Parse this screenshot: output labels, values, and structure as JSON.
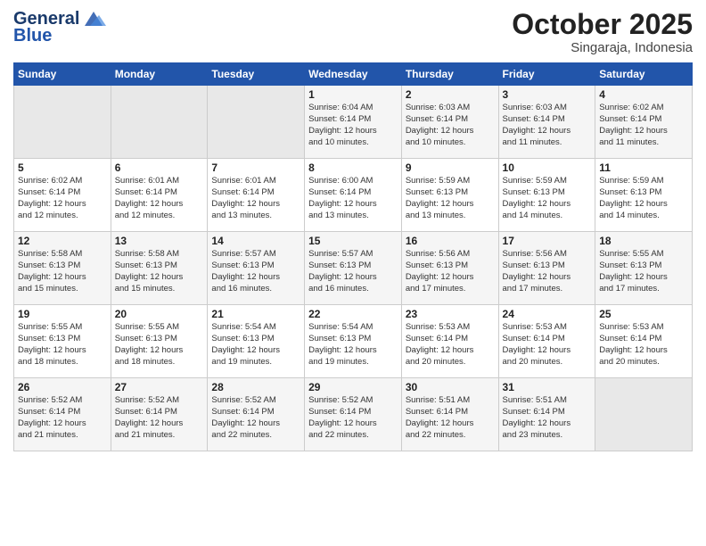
{
  "header": {
    "logo_line1": "General",
    "logo_line2": "Blue",
    "month": "October 2025",
    "location": "Singaraja, Indonesia"
  },
  "weekdays": [
    "Sunday",
    "Monday",
    "Tuesday",
    "Wednesday",
    "Thursday",
    "Friday",
    "Saturday"
  ],
  "weeks": [
    [
      {
        "day": "",
        "info": ""
      },
      {
        "day": "",
        "info": ""
      },
      {
        "day": "",
        "info": ""
      },
      {
        "day": "1",
        "info": "Sunrise: 6:04 AM\nSunset: 6:14 PM\nDaylight: 12 hours\nand 10 minutes."
      },
      {
        "day": "2",
        "info": "Sunrise: 6:03 AM\nSunset: 6:14 PM\nDaylight: 12 hours\nand 10 minutes."
      },
      {
        "day": "3",
        "info": "Sunrise: 6:03 AM\nSunset: 6:14 PM\nDaylight: 12 hours\nand 11 minutes."
      },
      {
        "day": "4",
        "info": "Sunrise: 6:02 AM\nSunset: 6:14 PM\nDaylight: 12 hours\nand 11 minutes."
      }
    ],
    [
      {
        "day": "5",
        "info": "Sunrise: 6:02 AM\nSunset: 6:14 PM\nDaylight: 12 hours\nand 12 minutes."
      },
      {
        "day": "6",
        "info": "Sunrise: 6:01 AM\nSunset: 6:14 PM\nDaylight: 12 hours\nand 12 minutes."
      },
      {
        "day": "7",
        "info": "Sunrise: 6:01 AM\nSunset: 6:14 PM\nDaylight: 12 hours\nand 13 minutes."
      },
      {
        "day": "8",
        "info": "Sunrise: 6:00 AM\nSunset: 6:14 PM\nDaylight: 12 hours\nand 13 minutes."
      },
      {
        "day": "9",
        "info": "Sunrise: 5:59 AM\nSunset: 6:13 PM\nDaylight: 12 hours\nand 13 minutes."
      },
      {
        "day": "10",
        "info": "Sunrise: 5:59 AM\nSunset: 6:13 PM\nDaylight: 12 hours\nand 14 minutes."
      },
      {
        "day": "11",
        "info": "Sunrise: 5:59 AM\nSunset: 6:13 PM\nDaylight: 12 hours\nand 14 minutes."
      }
    ],
    [
      {
        "day": "12",
        "info": "Sunrise: 5:58 AM\nSunset: 6:13 PM\nDaylight: 12 hours\nand 15 minutes."
      },
      {
        "day": "13",
        "info": "Sunrise: 5:58 AM\nSunset: 6:13 PM\nDaylight: 12 hours\nand 15 minutes."
      },
      {
        "day": "14",
        "info": "Sunrise: 5:57 AM\nSunset: 6:13 PM\nDaylight: 12 hours\nand 16 minutes."
      },
      {
        "day": "15",
        "info": "Sunrise: 5:57 AM\nSunset: 6:13 PM\nDaylight: 12 hours\nand 16 minutes."
      },
      {
        "day": "16",
        "info": "Sunrise: 5:56 AM\nSunset: 6:13 PM\nDaylight: 12 hours\nand 17 minutes."
      },
      {
        "day": "17",
        "info": "Sunrise: 5:56 AM\nSunset: 6:13 PM\nDaylight: 12 hours\nand 17 minutes."
      },
      {
        "day": "18",
        "info": "Sunrise: 5:55 AM\nSunset: 6:13 PM\nDaylight: 12 hours\nand 17 minutes."
      }
    ],
    [
      {
        "day": "19",
        "info": "Sunrise: 5:55 AM\nSunset: 6:13 PM\nDaylight: 12 hours\nand 18 minutes."
      },
      {
        "day": "20",
        "info": "Sunrise: 5:55 AM\nSunset: 6:13 PM\nDaylight: 12 hours\nand 18 minutes."
      },
      {
        "day": "21",
        "info": "Sunrise: 5:54 AM\nSunset: 6:13 PM\nDaylight: 12 hours\nand 19 minutes."
      },
      {
        "day": "22",
        "info": "Sunrise: 5:54 AM\nSunset: 6:13 PM\nDaylight: 12 hours\nand 19 minutes."
      },
      {
        "day": "23",
        "info": "Sunrise: 5:53 AM\nSunset: 6:14 PM\nDaylight: 12 hours\nand 20 minutes."
      },
      {
        "day": "24",
        "info": "Sunrise: 5:53 AM\nSunset: 6:14 PM\nDaylight: 12 hours\nand 20 minutes."
      },
      {
        "day": "25",
        "info": "Sunrise: 5:53 AM\nSunset: 6:14 PM\nDaylight: 12 hours\nand 20 minutes."
      }
    ],
    [
      {
        "day": "26",
        "info": "Sunrise: 5:52 AM\nSunset: 6:14 PM\nDaylight: 12 hours\nand 21 minutes."
      },
      {
        "day": "27",
        "info": "Sunrise: 5:52 AM\nSunset: 6:14 PM\nDaylight: 12 hours\nand 21 minutes."
      },
      {
        "day": "28",
        "info": "Sunrise: 5:52 AM\nSunset: 6:14 PM\nDaylight: 12 hours\nand 22 minutes."
      },
      {
        "day": "29",
        "info": "Sunrise: 5:52 AM\nSunset: 6:14 PM\nDaylight: 12 hours\nand 22 minutes."
      },
      {
        "day": "30",
        "info": "Sunrise: 5:51 AM\nSunset: 6:14 PM\nDaylight: 12 hours\nand 22 minutes."
      },
      {
        "day": "31",
        "info": "Sunrise: 5:51 AM\nSunset: 6:14 PM\nDaylight: 12 hours\nand 23 minutes."
      },
      {
        "day": "",
        "info": ""
      }
    ]
  ]
}
